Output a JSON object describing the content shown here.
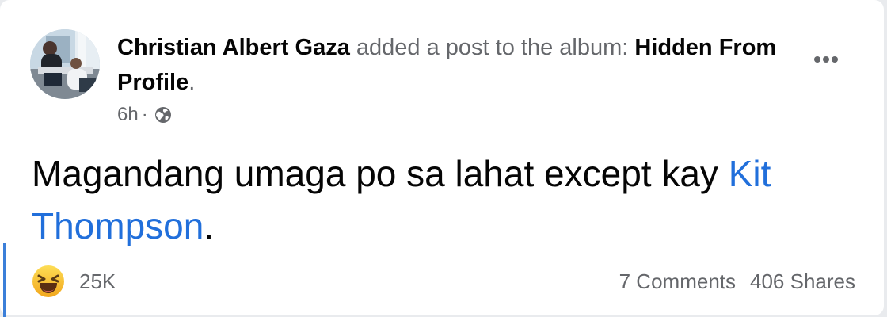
{
  "post": {
    "author_name": "Christian Albert Gaza",
    "action_text": " added a post to the album: ",
    "album_name": "Hidden From Profile",
    "action_end": ".",
    "timestamp": "6h",
    "separator": "·",
    "privacy_icon": "globe-icon",
    "more_icon": "more-options-icon",
    "body_prefix": "Magandang umaga po sa lahat except kay ",
    "mention": "Kit Thompson",
    "body_suffix": "."
  },
  "stats": {
    "reaction_icon": "haha-reaction-icon",
    "reaction_count": "25K",
    "comments": "7 Comments",
    "shares": "406 Shares"
  },
  "colors": {
    "mention_blue": "#216fdb",
    "secondary_text": "#65676b",
    "primary_text": "#050505",
    "reaction_yellow": "#f7b928"
  }
}
